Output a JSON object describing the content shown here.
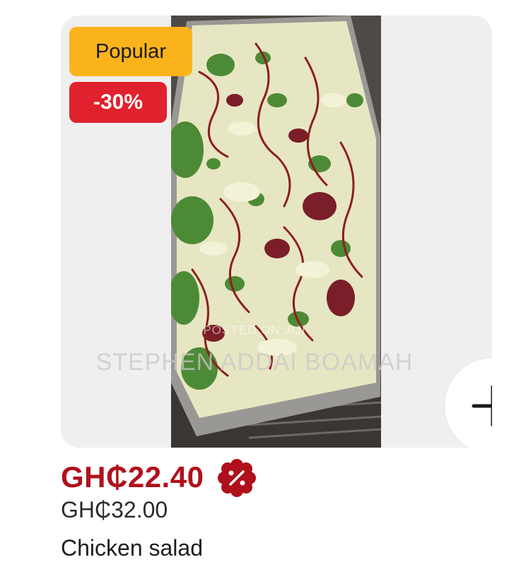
{
  "product": {
    "badges": {
      "popular": "Popular",
      "discount": "-30%"
    },
    "image_description": "salad-tray-photo",
    "price": "GH₵22.40",
    "old_price": "GH₵32.00",
    "name": "Chicken salad",
    "add_icon": "plus-icon",
    "promo_icon": "percent-badge-icon"
  },
  "watermark": {
    "line1": "POSTED ON JIJI",
    "line2": "STEPHEN ADDAI BOAMAH"
  },
  "colors": {
    "popular_badge": "#fbb31c",
    "discount_badge": "#e0212e",
    "price": "#b0101c",
    "card_bg": "#efefef"
  }
}
